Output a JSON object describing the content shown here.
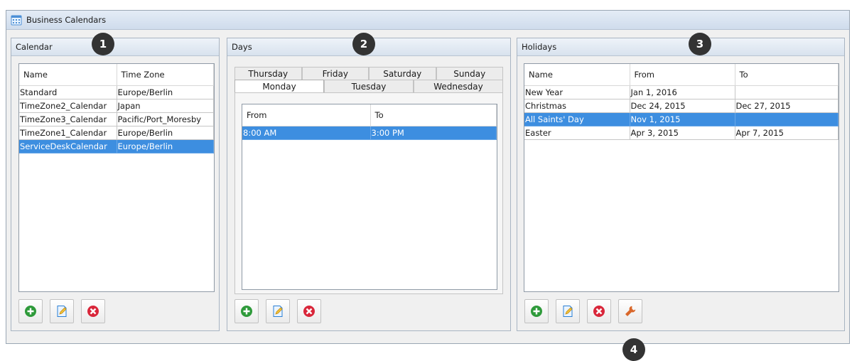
{
  "window": {
    "title": "Business Calendars"
  },
  "calendar": {
    "title": "Calendar",
    "badge": "1",
    "columns": [
      "Name",
      "Time Zone"
    ],
    "rows": [
      [
        "Standard",
        "Europe/Berlin"
      ],
      [
        "TimeZone2_Calendar",
        "Japan"
      ],
      [
        "TimeZone3_Calendar",
        "Pacific/Port_Moresby"
      ],
      [
        "TimeZone1_Calendar",
        "Europe/Berlin"
      ],
      [
        "ServiceDeskCalendar",
        "Europe/Berlin"
      ]
    ],
    "selected_row": 4
  },
  "days": {
    "title": "Days",
    "badge": "2",
    "tabs_back": [
      "Thursday",
      "Friday",
      "Saturday",
      "Sunday"
    ],
    "tabs_front": [
      "Monday",
      "Tuesday",
      "Wednesday"
    ],
    "active_tab": "Monday",
    "columns": [
      "From",
      "To"
    ],
    "rows": [
      [
        "8:00 AM",
        "3:00 PM"
      ]
    ],
    "selected_row": 0
  },
  "holidays": {
    "title": "Holidays",
    "badge": "3",
    "columns": [
      "Name",
      "From",
      "To"
    ],
    "rows": [
      [
        "New Year",
        "Jan 1, 2016",
        ""
      ],
      [
        "Christmas",
        "Dec 24, 2015",
        "Dec 27, 2015"
      ],
      [
        "All Saints' Day",
        "Nov 1, 2015",
        ""
      ],
      [
        "Easter",
        "Apr 3, 2015",
        "Apr 7, 2015"
      ]
    ],
    "selected_row": 2,
    "tools_badge": "4"
  },
  "colors": {
    "selection": "#3d8ee0",
    "add": "#2e9a3a",
    "delete": "#d9263a",
    "edit": "#2a7fd4",
    "wrench": "#d9672a",
    "badge": "#333333"
  },
  "icons": {
    "add": "plus-circle-icon",
    "edit": "edit-document-icon",
    "delete": "x-circle-icon",
    "tools": "wrench-icon",
    "window": "calendar-icon"
  }
}
